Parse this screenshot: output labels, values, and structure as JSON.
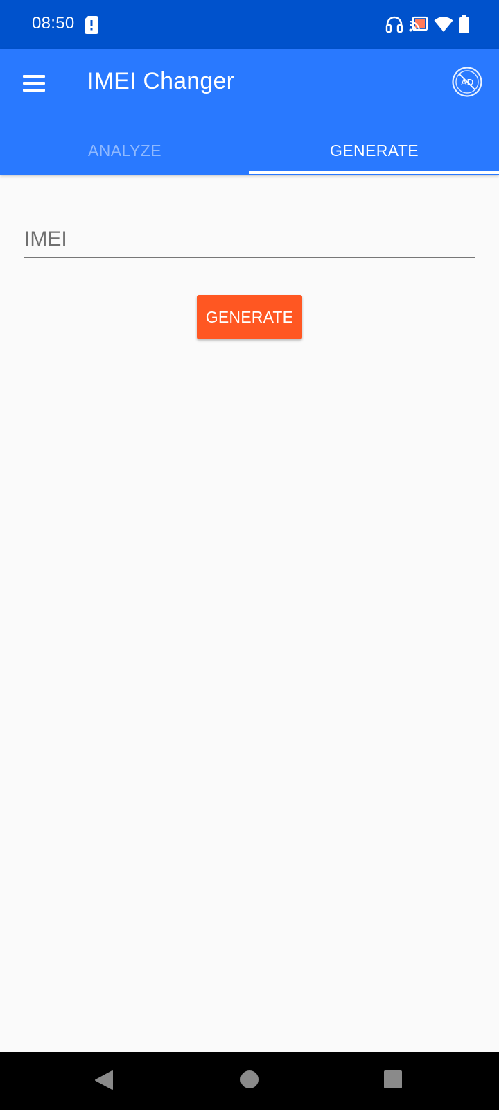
{
  "status_bar": {
    "time": "08:50",
    "icons": [
      "sim-alert-icon",
      "headphones-icon",
      "cast-icon",
      "wifi-icon",
      "battery-icon"
    ]
  },
  "app_bar": {
    "title": "IMEI Changer",
    "menu_icon": "hamburger-menu-icon",
    "action_icon": "no-ads-icon",
    "action_icon_text": "AD",
    "color": "#2979ff"
  },
  "tabs": [
    {
      "label": "ANALYZE",
      "selected": false
    },
    {
      "label": "GENERATE",
      "selected": true
    }
  ],
  "form": {
    "imei_placeholder": "IMEI",
    "imei_value": "",
    "generate_label": "GENERATE",
    "button_color": "#ff5722"
  },
  "nav_bar": {
    "icons": [
      "back-icon",
      "home-icon",
      "recents-icon"
    ]
  }
}
